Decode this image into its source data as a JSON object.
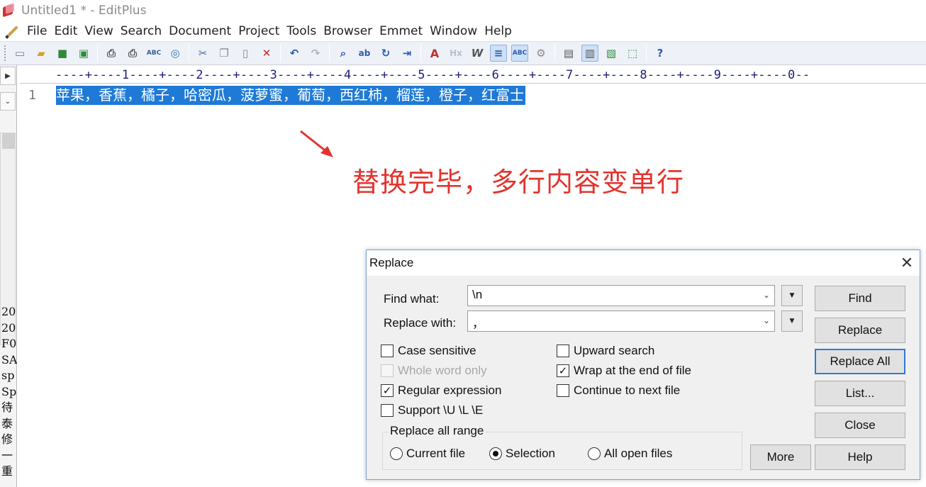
{
  "window": {
    "title": "Untitled1 * - EditPlus"
  },
  "menu": [
    "File",
    "Edit",
    "View",
    "Search",
    "Document",
    "Project",
    "Tools",
    "Browser",
    "Emmet",
    "Window",
    "Help"
  ],
  "toolbar": {
    "icons": [
      "new-file-icon",
      "open-folder-icon",
      "save-icon",
      "save-all-icon",
      "print-preview-icon",
      "print-icon",
      "spell-check-icon",
      "browser-preview-icon",
      "cut-icon",
      "copy-icon",
      "paste-icon",
      "delete-icon",
      "undo-icon",
      "redo-icon",
      "find-icon",
      "replace-icon",
      "go-to-icon",
      "indent-icon",
      "font-icon",
      "html-toolbar-icon",
      "word-wrap-icon",
      "line-number-icon",
      "column-icon",
      "settings-icon",
      "output-window-icon",
      "directory-window-icon",
      "cliptext-icon",
      "fullscreen-icon",
      "help-icon"
    ]
  },
  "left_panel": {
    "items": [
      "20",
      "20",
      "F0",
      "SA",
      "sp",
      "Sp",
      "待",
      "泰",
      "修",
      "一",
      "重"
    ]
  },
  "ruler": {
    "text": "----+----1----+----2----+----3----+----4----+----5----+----6----+----7----+----8----+----9----+----0--"
  },
  "editor": {
    "line_number": "1",
    "line_text": "苹果，香蕉，橘子，哈密瓜，菠萝蜜，葡萄，西红柿，榴莲，橙子，红富士"
  },
  "annotation": {
    "text": "替换完毕，多行内容变单行",
    "color": "#e3332e"
  },
  "dialog": {
    "title": "Replace",
    "find_label": "Find what:",
    "find_value": "\\n",
    "replace_label": "Replace with:",
    "replace_value": "，",
    "options": {
      "case_sensitive": "Case sensitive",
      "whole_word": "Whole word only",
      "regex": "Regular expression",
      "support_ule": "Support \\U \\L \\E",
      "upward": "Upward search",
      "wrap": "Wrap at the end of file",
      "continue_next": "Continue to next file"
    },
    "range_label": "Replace all range",
    "range_options": {
      "current": "Current file",
      "selection": "Selection",
      "all_open": "All open files"
    },
    "buttons": {
      "find": "Find",
      "replace": "Replace",
      "replace_all": "Replace All",
      "list": "List...",
      "close": "Close",
      "more": "More",
      "help": "Help"
    }
  },
  "colors": {
    "selection": "#1e7ad6",
    "default_button_border": "#2f7ad6"
  }
}
